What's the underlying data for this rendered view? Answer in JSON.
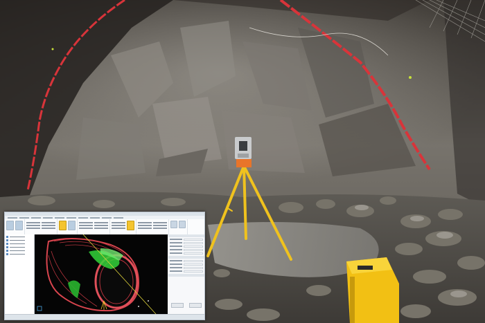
{
  "scene": {
    "description_icons": [
      "tunnel-rock-wall",
      "laser-scanner",
      "tripod",
      "water-puddle",
      "scanner-case"
    ]
  },
  "software": {
    "window_name": "tunnel-scan-viewer",
    "colors": {
      "tunnel_shell": "#d9454e",
      "point_cloud": "#32d43a",
      "ribbon_highlight": "#f4c430",
      "viewport_bg": "#050505"
    }
  },
  "colors": {
    "paint_line": "#d8343a",
    "tripod_leg": "#f0c21e",
    "case_yellow": "#f2c014",
    "rock": "#6f6c67"
  }
}
